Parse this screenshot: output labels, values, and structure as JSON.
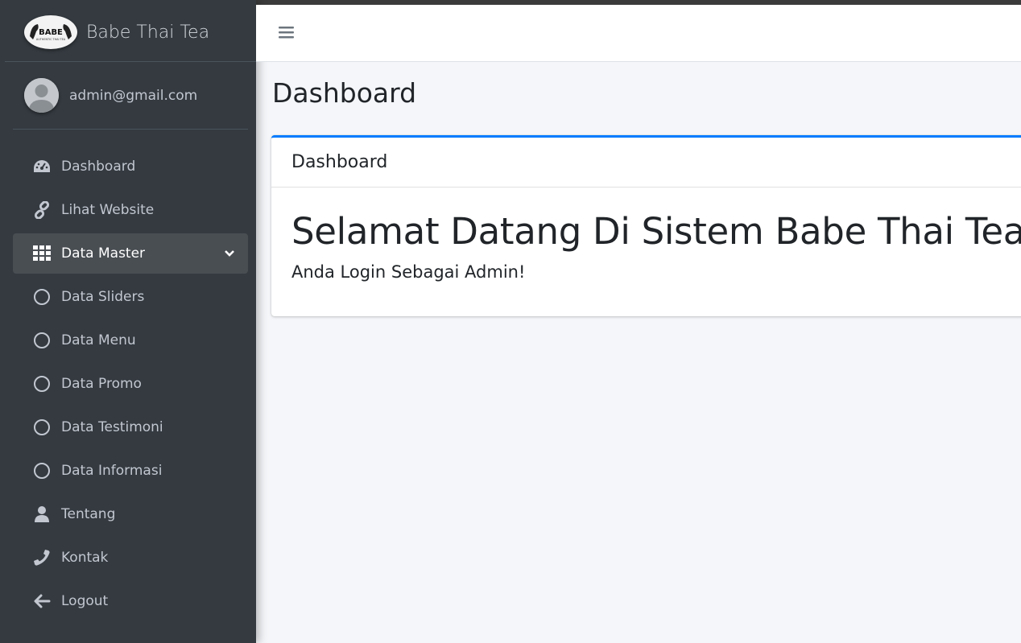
{
  "brand": {
    "name": "Babe Thai Tea",
    "logo_text": "BABE",
    "logo_tagline": "AUTHENTIC THAI TEA"
  },
  "user": {
    "email": "admin@gmail.com"
  },
  "sidebar": {
    "items": [
      {
        "label": "Dashboard",
        "icon": "dashboard-icon"
      },
      {
        "label": "Lihat Website",
        "icon": "link-icon"
      },
      {
        "label": "Data Master",
        "icon": "grid-icon"
      },
      {
        "label": "Data Sliders",
        "icon": "circle-icon"
      },
      {
        "label": "Data Menu",
        "icon": "circle-icon"
      },
      {
        "label": "Data Promo",
        "icon": "circle-icon"
      },
      {
        "label": "Data Testimoni",
        "icon": "circle-icon"
      },
      {
        "label": "Data Informasi",
        "icon": "circle-icon"
      },
      {
        "label": "Tentang",
        "icon": "user-icon"
      },
      {
        "label": "Kontak",
        "icon": "phone-icon"
      },
      {
        "label": "Logout",
        "icon": "arrow-left-icon"
      }
    ]
  },
  "page": {
    "title": "Dashboard",
    "card": {
      "header": "Dashboard",
      "welcome": "Selamat Datang Di Sistem Babe Thai Tea!",
      "subtext": "Anda Login Sebagai Admin!"
    }
  },
  "colors": {
    "sidebar_bg": "#343a40",
    "accent": "#007bff",
    "content_bg": "#f4f6f9"
  }
}
